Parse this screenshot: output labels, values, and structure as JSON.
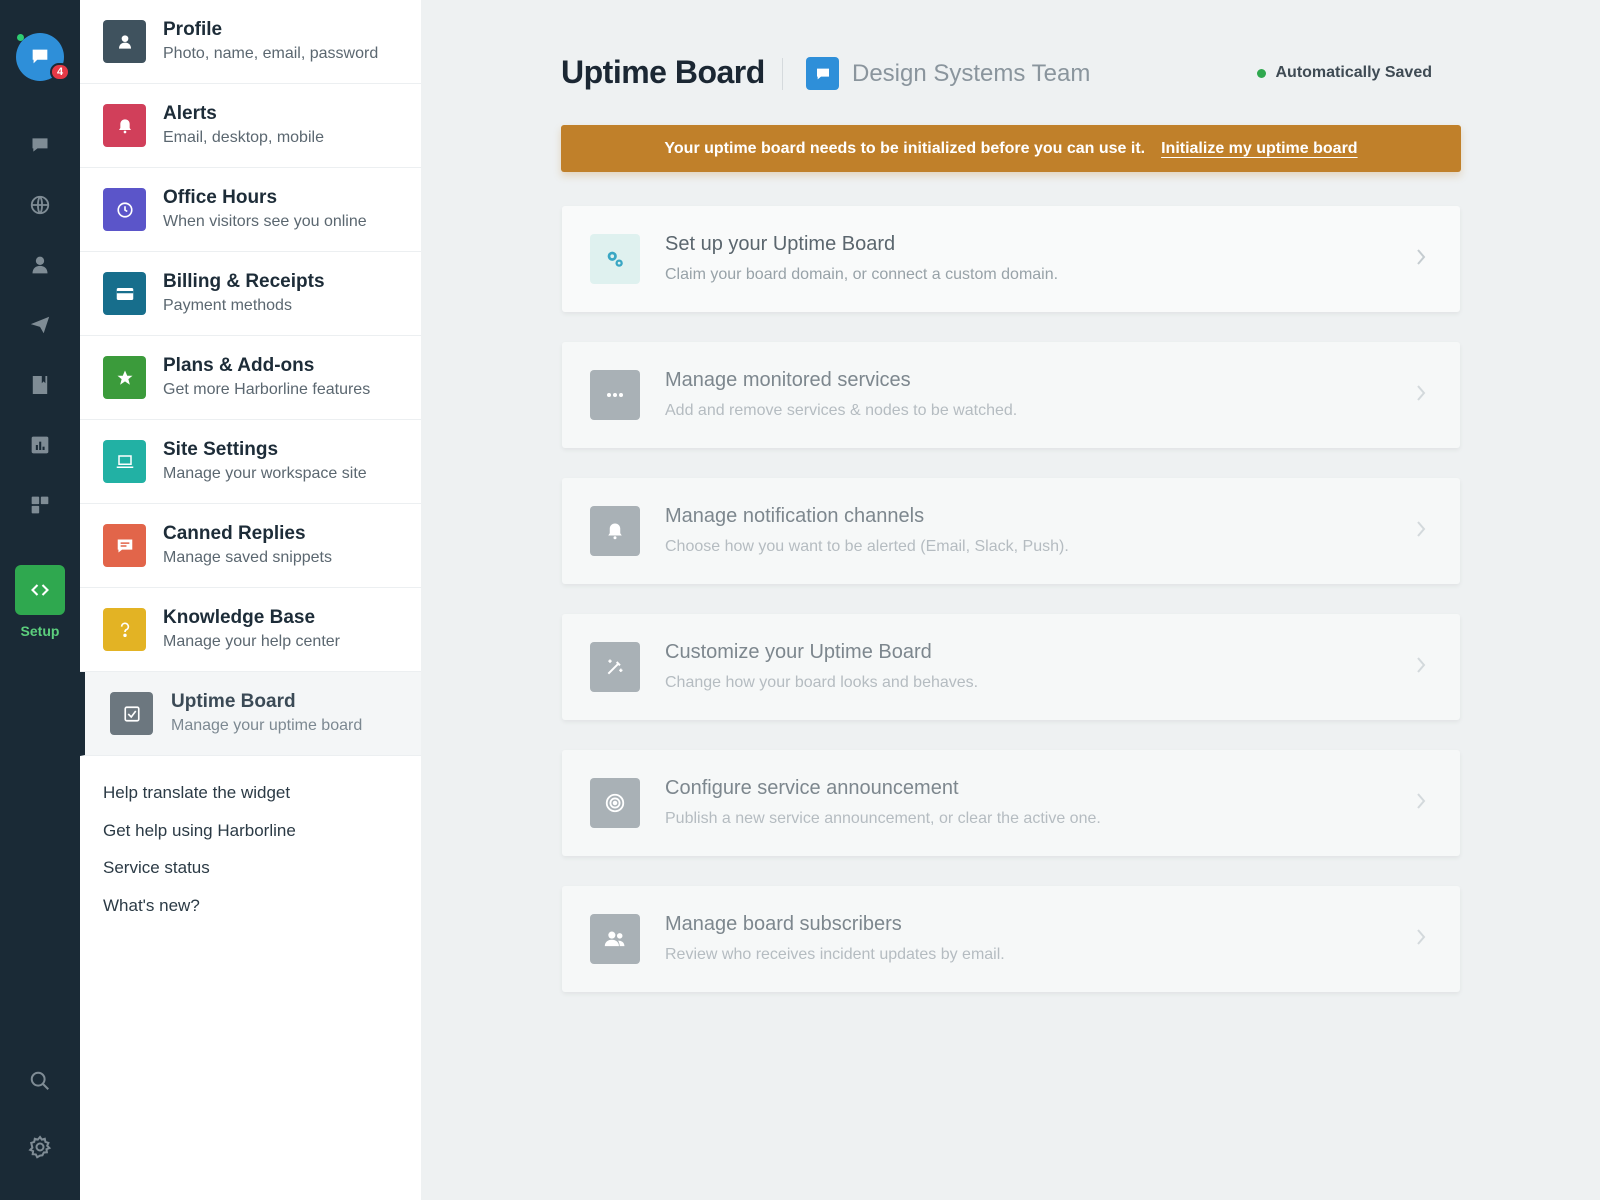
{
  "rail": {
    "notification_count": "4",
    "setup_label": "Setup",
    "icons": [
      "chat-icon",
      "globe-icon",
      "user-icon",
      "send-icon",
      "book-icon",
      "analytics-icon",
      "plugins-icon"
    ]
  },
  "menu": {
    "items": [
      {
        "title": "Profile",
        "subtitle": "Photo, name, email, password",
        "icon": "user-icon",
        "color": "#3f525e"
      },
      {
        "title": "Alerts",
        "subtitle": "Email, desktop, mobile",
        "icon": "bell-icon",
        "color": "#d13f5a"
      },
      {
        "title": "Office Hours",
        "subtitle": "When visitors see you online",
        "icon": "clock-icon",
        "color": "#5b55c9"
      },
      {
        "title": "Billing & Receipts",
        "subtitle": "Payment methods",
        "icon": "credit-card-icon",
        "color": "#176e8c"
      },
      {
        "title": "Plans & Add-ons",
        "subtitle": "Get more Harborline features",
        "icon": "star-icon",
        "color": "#3b9b3b"
      },
      {
        "title": "Site Settings",
        "subtitle": "Manage your workspace site",
        "icon": "laptop-icon",
        "color": "#22b1a4"
      },
      {
        "title": "Canned Replies",
        "subtitle": "Manage saved snippets",
        "icon": "message-icon",
        "color": "#e2654a"
      },
      {
        "title": "Knowledge Base",
        "subtitle": "Manage your help center",
        "icon": "question-icon",
        "color": "#e3b324"
      },
      {
        "title": "Uptime Board",
        "subtitle": "Manage your uptime board",
        "icon": "checkbox-icon",
        "color": "#6c777f"
      }
    ],
    "links": [
      "Help translate the widget",
      "Get help using Harborline",
      "Service status",
      "What's new?"
    ]
  },
  "header": {
    "title": "Uptime Board",
    "team": "Design Systems Team",
    "saved_status": "Automatically Saved"
  },
  "banner": {
    "message": "Your uptime board needs to be initialized before you can use it.",
    "link": "Initialize my uptime board",
    "color": "#c0802a"
  },
  "cards": [
    {
      "title": "Set up your Uptime Board",
      "subtitle": "Claim your board domain, or connect a custom domain.",
      "icon": "gears-icon"
    },
    {
      "title": "Manage monitored services",
      "subtitle": "Add and remove services & nodes to be watched.",
      "icon": "more-icon"
    },
    {
      "title": "Manage notification channels",
      "subtitle": "Choose how you want to be alerted (Email, Slack, Push).",
      "icon": "bell-icon"
    },
    {
      "title": "Customize your Uptime Board",
      "subtitle": "Change how your board looks and behaves.",
      "icon": "magic-wand-icon"
    },
    {
      "title": "Configure service announcement",
      "subtitle": "Publish a new service announcement, or clear the active one.",
      "icon": "target-icon"
    },
    {
      "title": "Manage board subscribers",
      "subtitle": "Review who receives incident updates by email.",
      "icon": "users-icon"
    }
  ]
}
